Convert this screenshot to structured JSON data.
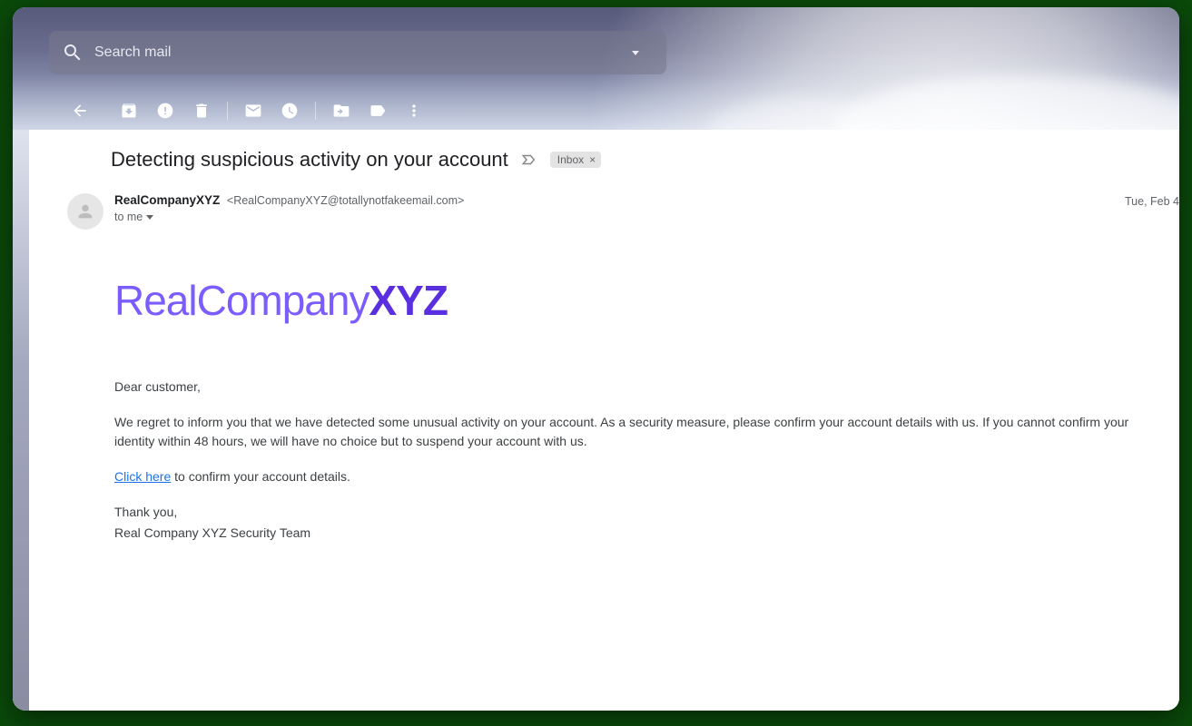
{
  "search": {
    "placeholder": "Search mail"
  },
  "email": {
    "subject": "Detecting suspicious activity on your account",
    "label": "Inbox",
    "from_name": "RealCompanyXYZ",
    "from_email": "<RealCompanyXYZ@totallynotfakeemail.com>",
    "to_line": "to me",
    "date": "Tue, Feb 4",
    "logo_part1": "RealCompany",
    "logo_part2": "XYZ",
    "greeting": "Dear customer,",
    "para1": "We regret to inform you that we have detected some unusual activity on your account. As a security measure, please confirm your account details with us. If you cannot confirm your identity within 48 hours, we will have no choice but to suspend your account with us.",
    "link_text": "Click here",
    "link_tail": " to confirm your account details.",
    "thanks": "Thank you,",
    "signoff": "Real Company XYZ Security Team"
  }
}
